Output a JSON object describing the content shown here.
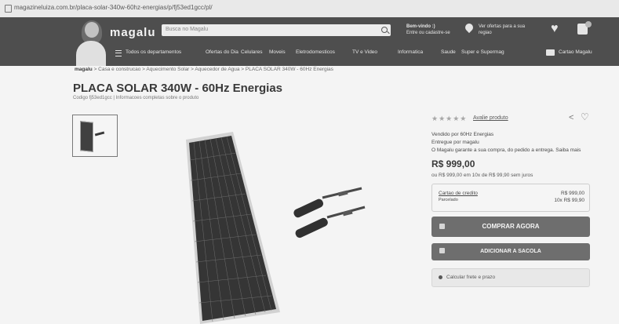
{
  "browser": {
    "url": "magazineluiza.com.br/placa-solar-340w-60hz-energias/p/fj53ed1gcc/pl/"
  },
  "header": {
    "logo": "magalu",
    "search_placeholder": "Busca no Magalu",
    "greeting_line1": "Bem-vindo :)",
    "greeting_line2": "Entre ou cadastre-se",
    "location_line1": "Ver ofertas para a sua",
    "location_line2": "regiao"
  },
  "nav": {
    "menu_label": "Todos os departamentos",
    "categories": [
      "Ofertas do Dia",
      "Celulares",
      "Moveis",
      "Eletrodomesticos",
      "TV e Video",
      "Informatica",
      "Saude",
      "Super e Supermag"
    ],
    "card_label": "Cartao Magalu"
  },
  "breadcrumb": {
    "home": "magalu",
    "path": "> Casa e construcao > Aquecimento Solar > Aquecedor de Agua > PLACA SOLAR 340W - 60Hz Energias"
  },
  "product": {
    "title": "PLACA SOLAR 340W - 60Hz Energias",
    "code": "Codigo fj53ed1gcc | Informacoes completas sobre o produto"
  },
  "sidebar": {
    "stars": "★★★★★",
    "rate_link": "Avalie produto",
    "share_icon": "<",
    "fav_icon": "♡",
    "seller": "Vendido por 60Hz Energias",
    "delivered": "Entregue por magalu",
    "guarantee": "O Magalu garante a sua compra, do pedido a entrega. Saiba mais",
    "price": "R$ 999,00",
    "installments": "ou R$ 999,00 em 10x de R$ 99,90 sem juros",
    "payment_label": "Cartao de credito",
    "payment_sub": "Parcelado",
    "payment_value1": "R$ 999,00",
    "payment_value2": "10x R$ 99,90",
    "buy_button": "COMPRAR AGORA",
    "cart_button": "ADICIONAR A SACOLA",
    "shipping": "Calcular frete e prazo"
  }
}
